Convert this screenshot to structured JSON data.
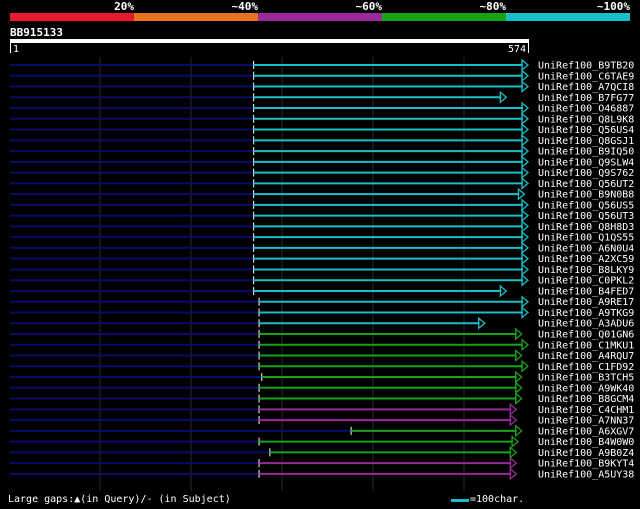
{
  "colors": {
    "background": "#000000",
    "identity_bins": [
      "#e8192c",
      "#e8731e",
      "#9a2a9a",
      "#17a317",
      "#17c0c8"
    ],
    "query_line": "#0a0a6a",
    "gridline": "#2a2a2a",
    "text": "#ffffff"
  },
  "identity_scale": {
    "labels": [
      "20%",
      "~40%",
      "~60%",
      "~80%",
      "~100%"
    ]
  },
  "query": {
    "name": "BB915133",
    "start_label": "1",
    "end_label": "574",
    "length": 574
  },
  "footer": {
    "gaps_text": "Large gaps:▲(in Query)/- (in Subject)",
    "scale_text": "=100char."
  },
  "chart_data": {
    "type": "alignment",
    "query_length": 574,
    "hits": [
      {
        "name": "UniRef100_B9TB20",
        "start": 270,
        "end": 574,
        "identity_bin": 4
      },
      {
        "name": "UniRef100_C6TAE9",
        "start": 270,
        "end": 574,
        "identity_bin": 4
      },
      {
        "name": "UniRef100_A7QCI8",
        "start": 270,
        "end": 574,
        "identity_bin": 4
      },
      {
        "name": "UniRef100_B7FG77",
        "start": 270,
        "end": 550,
        "identity_bin": 4
      },
      {
        "name": "UniRef100_O46887",
        "start": 270,
        "end": 574,
        "identity_bin": 4
      },
      {
        "name": "UniRef100_Q8L9K8",
        "start": 270,
        "end": 574,
        "identity_bin": 4
      },
      {
        "name": "UniRef100_Q56US4",
        "start": 270,
        "end": 574,
        "identity_bin": 4
      },
      {
        "name": "UniRef100_Q8GSJ1",
        "start": 270,
        "end": 574,
        "identity_bin": 4
      },
      {
        "name": "UniRef100_B9IQ50",
        "start": 270,
        "end": 574,
        "identity_bin": 4
      },
      {
        "name": "UniRef100_Q9SLW4",
        "start": 270,
        "end": 574,
        "identity_bin": 4
      },
      {
        "name": "UniRef100_Q9S762",
        "start": 270,
        "end": 574,
        "identity_bin": 4
      },
      {
        "name": "UniRef100_Q56UT2",
        "start": 270,
        "end": 574,
        "identity_bin": 4
      },
      {
        "name": "UniRef100_B9N0B8",
        "start": 270,
        "end": 570,
        "identity_bin": 4
      },
      {
        "name": "UniRef100_Q56US5",
        "start": 270,
        "end": 574,
        "identity_bin": 4
      },
      {
        "name": "UniRef100_Q56UT3",
        "start": 270,
        "end": 574,
        "identity_bin": 4
      },
      {
        "name": "UniRef100_Q8H8D3",
        "start": 270,
        "end": 574,
        "identity_bin": 4
      },
      {
        "name": "UniRef100_Q1QS55",
        "start": 270,
        "end": 574,
        "identity_bin": 4
      },
      {
        "name": "UniRef100_A6N0U4",
        "start": 270,
        "end": 574,
        "identity_bin": 4
      },
      {
        "name": "UniRef100_A2XC59",
        "start": 270,
        "end": 574,
        "identity_bin": 4
      },
      {
        "name": "UniRef100_B8LKY9",
        "start": 270,
        "end": 574,
        "identity_bin": 4
      },
      {
        "name": "UniRef100_C0PKL2",
        "start": 270,
        "end": 574,
        "identity_bin": 4
      },
      {
        "name": "UniRef100_B4FED7",
        "start": 270,
        "end": 550,
        "identity_bin": 4
      },
      {
        "name": "UniRef100_A9RE17",
        "start": 276,
        "end": 574,
        "identity_bin": 4
      },
      {
        "name": "UniRef100_A9TKG9",
        "start": 276,
        "end": 574,
        "identity_bin": 4
      },
      {
        "name": "UniRef100_A3ADU6",
        "start": 276,
        "end": 526,
        "identity_bin": 4
      },
      {
        "name": "UniRef100_Q01GN6",
        "start": 276,
        "end": 567,
        "identity_bin": 3
      },
      {
        "name": "UniRef100_C1MKU1",
        "start": 276,
        "end": 574,
        "identity_bin": 3
      },
      {
        "name": "UniRef100_A4RQU7",
        "start": 276,
        "end": 567,
        "identity_bin": 3
      },
      {
        "name": "UniRef100_C1FD92",
        "start": 276,
        "end": 574,
        "identity_bin": 3
      },
      {
        "name": "UniRef100_B3TCH5",
        "start": 279,
        "end": 567,
        "identity_bin": 3
      },
      {
        "name": "UniRef100_A9WK40",
        "start": 276,
        "end": 567,
        "identity_bin": 3
      },
      {
        "name": "UniRef100_B8GCM4",
        "start": 276,
        "end": 567,
        "identity_bin": 3
      },
      {
        "name": "UniRef100_C4CHM1",
        "start": 276,
        "end": 561,
        "identity_bin": 2
      },
      {
        "name": "UniRef100_A7NN37",
        "start": 276,
        "end": 561,
        "identity_bin": 2
      },
      {
        "name": "UniRef100_A6XGV7",
        "start": 378,
        "end": 567,
        "identity_bin": 3
      },
      {
        "name": "UniRef100_B4W0W0",
        "start": 276,
        "end": 563,
        "identity_bin": 3
      },
      {
        "name": "UniRef100_A9B0Z4",
        "start": 288,
        "end": 561,
        "identity_bin": 3
      },
      {
        "name": "UniRef100_B9KYT4",
        "start": 276,
        "end": 561,
        "identity_bin": 2
      },
      {
        "name": "UniRef100_A5UY38",
        "start": 276,
        "end": 561,
        "identity_bin": 2
      }
    ]
  }
}
